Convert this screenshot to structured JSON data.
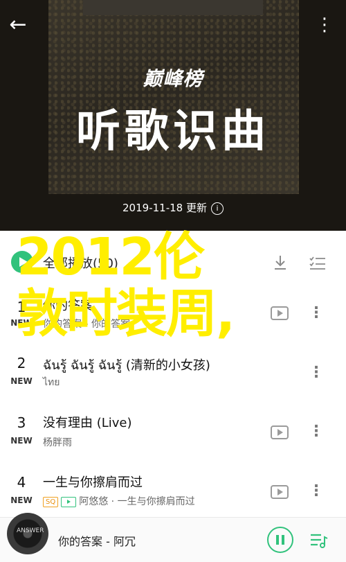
{
  "header": {
    "brand": "巅峰榜",
    "title": "听歌识曲",
    "update_text": "2019-11-18 更新",
    "info_icon": "info-icon"
  },
  "list_header": {
    "play_all_label": "全部播放(50)"
  },
  "songs": [
    {
      "rank": "1",
      "badge": "NEW",
      "title": "你的答案",
      "subtitle": "你的答案 - 你的答案"
    },
    {
      "rank": "2",
      "badge": "NEW",
      "title": "ฉันรู้ ฉันรู้ ฉันรู้ (清新的小女孩)",
      "subtitle": "ไทย"
    },
    {
      "rank": "3",
      "badge": "NEW",
      "title": "没有理由 (Live)",
      "subtitle": "杨胖雨"
    },
    {
      "rank": "4",
      "badge": "NEW",
      "title": "一生与你擦肩而过",
      "sq": "SQ",
      "subtitle": "阿悠悠 · 一生与你擦肩而过"
    }
  ],
  "overlay": {
    "line1": "2012伦",
    "line2": "敦时装周,"
  },
  "player": {
    "now_playing": "你的答案 - 阿冗",
    "cover_label": "ANSWER"
  },
  "colors": {
    "accent": "#31c27c",
    "overlay_text": "#ffee00",
    "header_bg": "#2b2720"
  }
}
